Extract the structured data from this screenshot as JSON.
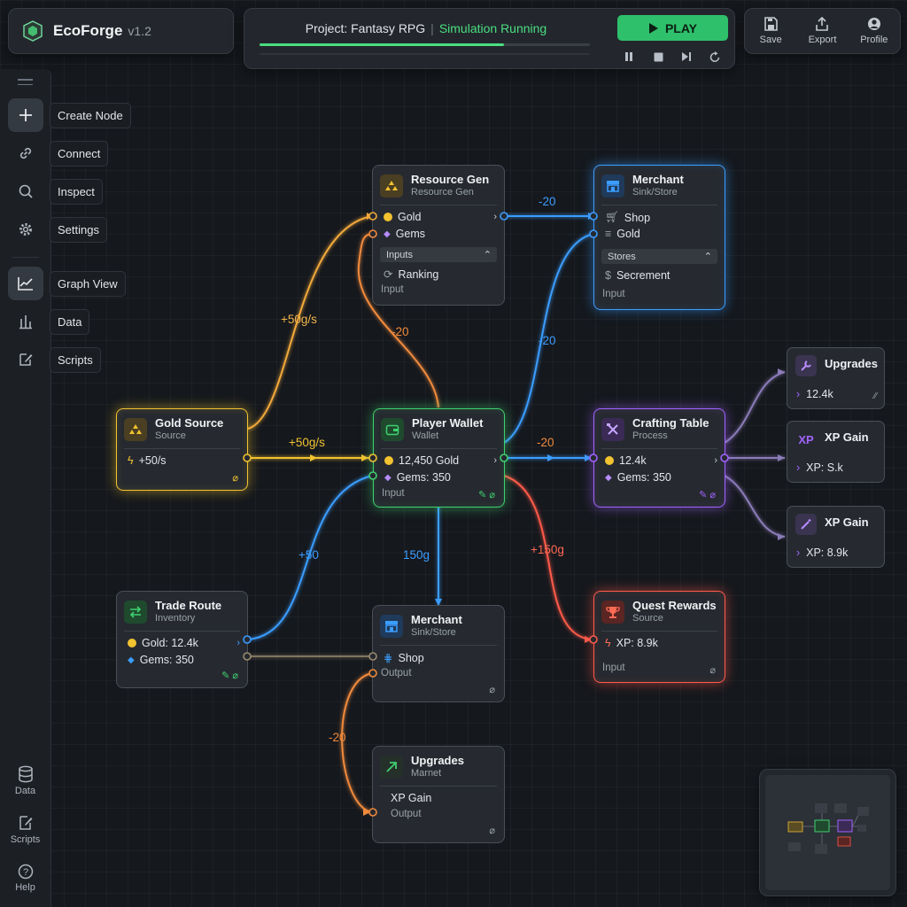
{
  "app": {
    "name": "EcoForge",
    "version": "v1.2"
  },
  "project": {
    "title": "Project: Fantasy RPG",
    "status": "Simulation Running",
    "progress_percent": 74
  },
  "controls": {
    "play_label": "PLAY"
  },
  "top_tools": [
    {
      "label": "Save",
      "icon": "save-icon"
    },
    {
      "label": "Export",
      "icon": "export-icon"
    },
    {
      "label": "Profile",
      "icon": "profile-icon"
    }
  ],
  "sidebar": {
    "tools": [
      {
        "label": "Create Node",
        "icon": "plus-icon"
      },
      {
        "label": "Connect",
        "icon": "link-icon"
      },
      {
        "label": "Inspect",
        "icon": "search-icon"
      },
      {
        "label": "Settings",
        "icon": "gear-icon"
      },
      {
        "label": "Graph View",
        "icon": "line-chart-icon"
      },
      {
        "label": "Data",
        "icon": "bar-chart-icon"
      },
      {
        "label": "Scripts",
        "icon": "edit-icon"
      }
    ],
    "bottom": [
      {
        "label": "Data",
        "icon": "database-icon"
      },
      {
        "label": "Scripts",
        "icon": "script-icon"
      },
      {
        "label": "Help",
        "icon": "help-icon"
      }
    ]
  },
  "nodes": {
    "resource_gen": {
      "title": "Resource Gen",
      "subtitle": "Resource Gen",
      "rows": [
        "Gold",
        "Gems"
      ],
      "section": "Inputs",
      "section_item": "Ranking",
      "footer": "Input"
    },
    "merchant_top": {
      "title": "Merchant",
      "subtitle": "Sink/Store",
      "rows": [
        "Shop",
        "Gold"
      ],
      "section": "Stores",
      "section_item": "Secrement",
      "footer": "Input"
    },
    "gold_source": {
      "title": "Gold Source",
      "subtitle": "Source",
      "rate": "+50/s"
    },
    "player_wallet": {
      "title": "Player Wallet",
      "subtitle": "Wallet",
      "rows": [
        "12,450 Gold",
        "Gems: 350"
      ],
      "footer": "Input"
    },
    "crafting_table": {
      "title": "Crafting Table",
      "subtitle": "Process",
      "rows": [
        "12.4k",
        "Gems: 350"
      ]
    },
    "trade_route": {
      "title": "Trade Route",
      "subtitle": "Inventory",
      "rows": [
        "Gold: 12.4k",
        "Gems: 350"
      ]
    },
    "merchant_bottom": {
      "title": "Merchant",
      "subtitle": "Sink/Store",
      "rows": [
        "Shop"
      ],
      "footer": "Output"
    },
    "quest_rewards": {
      "title": "Quest Rewards",
      "subtitle": "Source",
      "rows": [
        "XP: 8.9k"
      ],
      "footer": "Input"
    },
    "upgrades_bottom": {
      "title": "Upgrades",
      "subtitle": "Marnet",
      "rows": [
        "XP Gain"
      ],
      "footer": "Output"
    },
    "upgrades_side": {
      "title": "Upgrades",
      "value": "12.4k"
    },
    "xp_gain_1": {
      "title": "XP Gain",
      "badge": "XP",
      "value": "XP: S.k"
    },
    "xp_gain_2": {
      "title": "XP Gain",
      "value": "XP: 8.9k"
    }
  },
  "edges": {
    "gold_to_resgen": "+50g/s",
    "gold_to_wallet": "+50g/s",
    "resgen_to_merchant": "-20",
    "wallet_to_resgen": "-20",
    "wallet_to_merchant": "-20",
    "wallet_to_crafting": "-20",
    "trade_to_wallet": "+50",
    "wallet_to_merchant_bottom": "150g",
    "wallet_to_quest": "+150g",
    "merchant_to_upgrades": "-20"
  },
  "colors": {
    "gold": "#f2c230",
    "green": "#3fd06f",
    "blue": "#3b9dff",
    "purple": "#a263ff",
    "red": "#ff5a4a",
    "orange": "#f08a3c",
    "gray": "#9aa1ab"
  }
}
